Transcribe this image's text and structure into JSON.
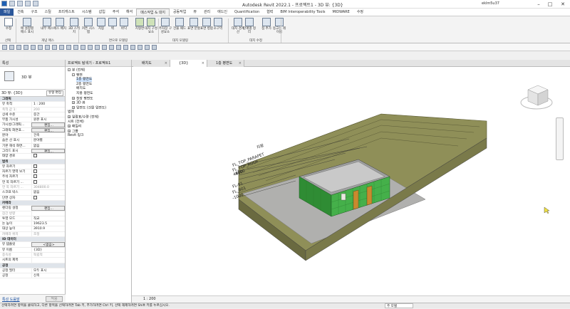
{
  "app": {
    "title": "Autodesk Revit 2022.1 - 프로젝트1 - 3D 뷰: {3D}",
    "user": "eklm5u37"
  },
  "tabs": [
    "파일",
    "건축",
    "구조",
    "스틸",
    "프리캐스트",
    "시스템",
    "삽입",
    "주석",
    "해석",
    "매스작업 & 대지",
    "공동작업",
    "뷰",
    "관리",
    "애드인",
    "Quantification",
    "협력",
    "BIM Interoperability Tools",
    "MIDWARE",
    "수정"
  ],
  "active_tab": "매스작업 & 대지",
  "ribbon": {
    "buttons": [
      {
        "label": "수정"
      },
      {
        "label": "매 설정별 매스 표시"
      },
      {
        "label": "내부 매스"
      },
      {
        "label": "매스 배치"
      },
      {
        "label": "3D 스케치"
      },
      {
        "label": "커튼 시스템"
      },
      {
        "label": "지붕"
      },
      {
        "label": "벽"
      },
      {
        "label": "바닥"
      },
      {
        "label": "지형면"
      },
      {
        "label": "대지 구성요소"
      },
      {
        "label": "주차장 구성요소"
      },
      {
        "label": "건물 패드"
      },
      {
        "label": "표면 분할"
      },
      {
        "label": "표면 병합"
      },
      {
        "label": "소구역"
      },
      {
        "label": "대지 경계선"
      },
      {
        "label": "단계별 정리"
      },
      {
        "label": "점 추가"
      },
      {
        "label": "등고선 레이블"
      }
    ],
    "groups": [
      "선택",
      "개념 매스",
      "면으로 모델링",
      "대지 모델링",
      "대지 수정"
    ]
  },
  "properties": {
    "header": "특성",
    "type_name": "3D 뷰",
    "filter": "3D 뷰: {3D}",
    "edit_type": "유형 편집",
    "rows": [
      {
        "k": "그래픽",
        "v": "",
        "cat": true
      },
      {
        "k": "뷰 축척",
        "v": "1 : 200"
      },
      {
        "k": "축척 값 1:",
        "v": "200",
        "dim": true
      },
      {
        "k": "상세 수준",
        "v": "중간"
      },
      {
        "k": "부품 가시성",
        "v": "원본 표시"
      },
      {
        "k": "가시성/그래픽...",
        "v": "편집...",
        "btn": true
      },
      {
        "k": "그래픽 화면표...",
        "v": "편집...",
        "btn": true
      },
      {
        "k": "분야",
        "v": "건축"
      },
      {
        "k": "숨은 선 표시",
        "v": "분야별"
      },
      {
        "k": "기본 해석 화면...",
        "v": "없음"
      },
      {
        "k": "그리드 표시",
        "v": "편집...",
        "btn": true
      },
      {
        "k": "태양 경로",
        "v": "",
        "chk": true
      },
      {
        "k": "범위",
        "v": "",
        "cat": true
      },
      {
        "k": "뷰 자르기",
        "v": "",
        "chk": true
      },
      {
        "k": "자르기 영역 보기",
        "v": "",
        "chk": true
      },
      {
        "k": "주석 자르기",
        "v": "",
        "chk": true
      },
      {
        "k": "먼 쪽 자르기 ...",
        "v": "",
        "chk": true
      },
      {
        "k": "먼 쪽 자르기 ...",
        "v": "304800.0",
        "dim": true
      },
      {
        "k": "스코프 박스",
        "v": "없음"
      },
      {
        "k": "단면 상자",
        "v": "",
        "chk": true
      },
      {
        "k": "카메라",
        "v": "",
        "cat": true
      },
      {
        "k": "렌더링 설정",
        "v": "편집...",
        "btn": true
      },
      {
        "k": "잠긴 방향",
        "v": "",
        "dim": true
      },
      {
        "k": "투영 모드",
        "v": "직교"
      },
      {
        "k": "눈 높이",
        "v": "19623.5"
      },
      {
        "k": "대상 높이",
        "v": "3910.9"
      },
      {
        "k": "카메라 위치",
        "v": "조정",
        "dim": true
      },
      {
        "k": "ID 데이터",
        "v": "",
        "cat": true
      },
      {
        "k": "뷰 템플릿",
        "v": "<없음>",
        "btn": true
      },
      {
        "k": "뷰 이름",
        "v": "{3D}"
      },
      {
        "k": "종속성",
        "v": "독립적",
        "dim": true
      },
      {
        "k": "시트의 제목",
        "v": ""
      },
      {
        "k": "공정",
        "v": "",
        "cat": true
      },
      {
        "k": "공정 필터",
        "v": "모두 표시"
      },
      {
        "k": "공정",
        "v": "신축"
      }
    ],
    "help": "특성 도움말",
    "apply": "적용"
  },
  "browser": {
    "header": "프로젝트 탐색기 - 프로젝트1",
    "items": [
      {
        "label": "뷰 (전체)",
        "depth": 0,
        "box": "-"
      },
      {
        "label": "평면",
        "depth": 1,
        "box": "-"
      },
      {
        "label": "1층 평면도",
        "depth": 2,
        "sel": true
      },
      {
        "label": "2층 평면도",
        "depth": 2
      },
      {
        "label": "배치도",
        "depth": 2
      },
      {
        "label": "지붕 평면도",
        "depth": 2
      },
      {
        "label": "천장 평면도",
        "depth": 1,
        "box": "+"
      },
      {
        "label": "3D 뷰",
        "depth": 1,
        "box": "+"
      },
      {
        "label": "입면도 (건물 입면도)",
        "depth": 1,
        "box": "+"
      },
      {
        "label": "범례",
        "depth": 0
      },
      {
        "label": "일람표/수량 (전체)",
        "depth": 0,
        "box": "+"
      },
      {
        "label": "시트 (전체)",
        "depth": 0
      },
      {
        "label": "패밀리",
        "depth": 0,
        "box": "+"
      },
      {
        "label": "그룹",
        "depth": 0,
        "box": "+"
      },
      {
        "label": "Revit 링크",
        "depth": 0
      }
    ]
  },
  "view_tabs": [
    {
      "label": "배치도",
      "active": false
    },
    {
      "label": "{3D}",
      "active": true
    },
    {
      "label": "1층 평면도",
      "active": false
    }
  ],
  "levels": [
    {
      "label": "지붕"
    },
    {
      "label": "FL_TOP_PARAPET"
    },
    {
      "label": "FL_TOP_ROOF"
    },
    {
      "label": "4800"
    },
    {
      "label": "4000"
    },
    {
      "label": "FL-01"
    },
    {
      "label": "FL_B01"
    },
    {
      "label": "-1000"
    }
  ],
  "viewport_status": {
    "scale": "1 : 200"
  },
  "status": {
    "hint": "선택하려면 항목을 클릭하고, 다른 항목을 선택하려면 Tab 키, 추가하려면 Ctrl 키, 선택 해제하려면 Shift 키를 누르십시오.",
    "model": "주 모델"
  },
  "colors": {
    "accent": "#2b579a",
    "terrain": "#8a8a52",
    "walls": "#3fae45",
    "door": "#c98a2e"
  }
}
